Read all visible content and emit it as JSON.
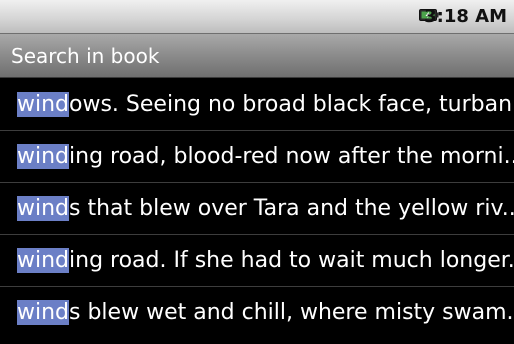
{
  "status_bar": {
    "icon": "battery-charging-icon",
    "time": "3:18 AM"
  },
  "title_bar": {
    "title": "Search in book"
  },
  "highlight_color": "#6b7fc6",
  "results": [
    {
      "match": "wind",
      "rest": "ows. Seeing no broad black face, turban..."
    },
    {
      "match": "wind",
      "rest": "ing road, blood-red now after the morni..."
    },
    {
      "match": "wind",
      "rest": "s that blew over Tara and the yellow riv..."
    },
    {
      "match": "wind",
      "rest": "ing road. If she had to wait much longer..."
    },
    {
      "match": "wind",
      "rest": "s blew wet and chill, where misty swam..."
    }
  ]
}
